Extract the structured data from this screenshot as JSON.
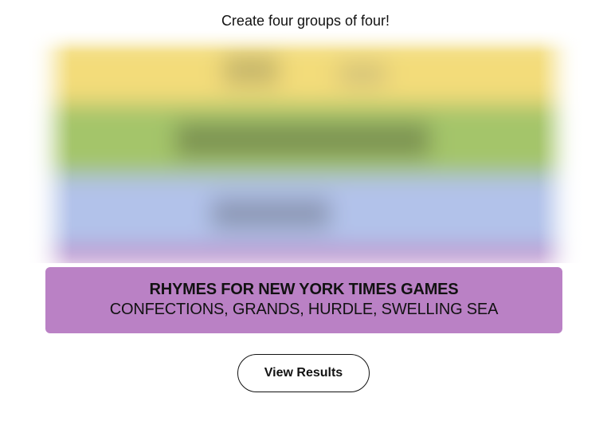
{
  "header": {
    "instructions": "Create four groups of four!"
  },
  "board": {
    "state": "blurred",
    "band_colors": [
      "#f3dc7a",
      "#a4c56a",
      "#b2c2ea",
      "#ba81c5"
    ]
  },
  "solved_group": {
    "title": "RHYMES FOR NEW YORK TIMES GAMES",
    "members": "CONFECTIONS, GRANDS, HURDLE, SWELLING SEA",
    "color": "#ba81c5"
  },
  "actions": {
    "view_results_label": "View Results"
  }
}
